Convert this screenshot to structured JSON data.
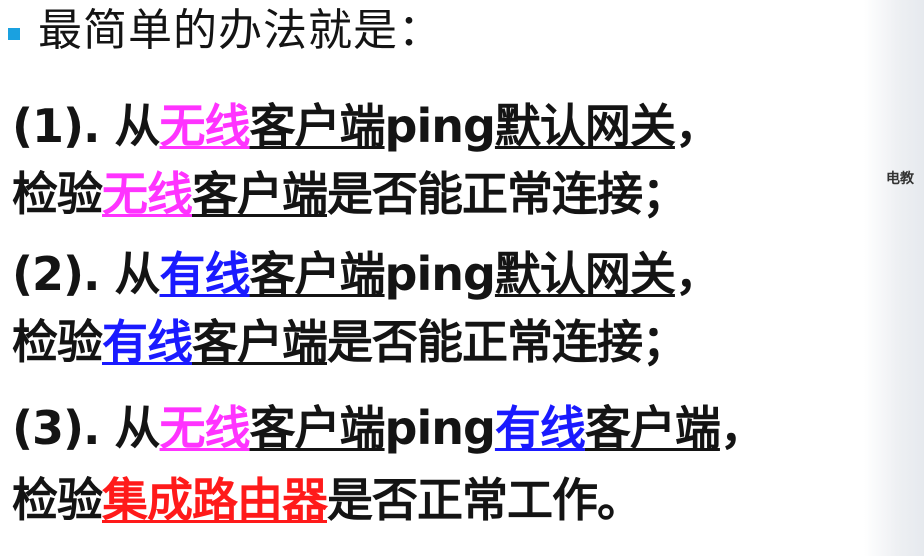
{
  "side_note": "电教",
  "colors": {
    "bullet": "#1aa1e0",
    "magenta": "#ff33ff",
    "blue": "#1a1aff",
    "red": "#ff1a1a",
    "text": "#141414"
  },
  "heading": "最简单的办法就是：",
  "lines": [
    {
      "prefix": "(1). 从",
      "kw1": "无线",
      "client": "客户端",
      "ping": "ping",
      "target": "默认网关",
      "end": "，"
    },
    {
      "check": "检验",
      "kw": "无线",
      "client": "客户端",
      "rest": "是否能正常连接；"
    },
    {
      "prefix": "(2). 从",
      "kw1": "有线",
      "client": "客户端",
      "ping": "ping",
      "target": "默认网关",
      "end": "，"
    },
    {
      "check": "检验",
      "kw": "有线",
      "client": "客户端",
      "rest": "是否能正常连接；"
    },
    {
      "prefix": "(3). 从",
      "kw1": "无线",
      "client": "客户端",
      "ping": "ping",
      "kw2": "有线",
      "client2": "客户端",
      "end": "，"
    },
    {
      "check": "检验",
      "kw": "集成路由器",
      "rest": "是否正常工作。"
    }
  ]
}
